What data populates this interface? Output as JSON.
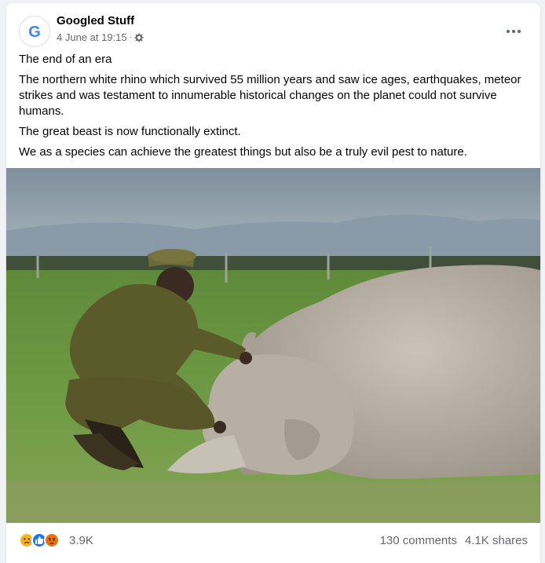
{
  "post": {
    "author": "Googled Stuff",
    "timestamp": "4 June at 19:15",
    "separator": "·",
    "privacy_icon": "gear-icon",
    "paragraphs": [
      "The end of an era",
      "The northern white rhino which survived 55 million years and saw ice ages, earthquakes, meteor strikes and was testament to innumerable historical changes on the planet could not survive humans.",
      "The great beast is now functionally extinct.",
      "We as a species can achieve the greatest things but also be a truly evil pest to nature."
    ],
    "image_icon": "photo-ranger-and-rhino"
  },
  "footer": {
    "reaction_icons": [
      "sad-reaction-icon",
      "like-reaction-icon",
      "angry-reaction-icon"
    ],
    "reaction_count": "3.9K",
    "comments": "130 comments",
    "shares": "4.1K shares"
  },
  "colors": {
    "brand_blue": "#1877f2",
    "google_blue": "#4285f4",
    "secondary_text": "#65676b"
  }
}
